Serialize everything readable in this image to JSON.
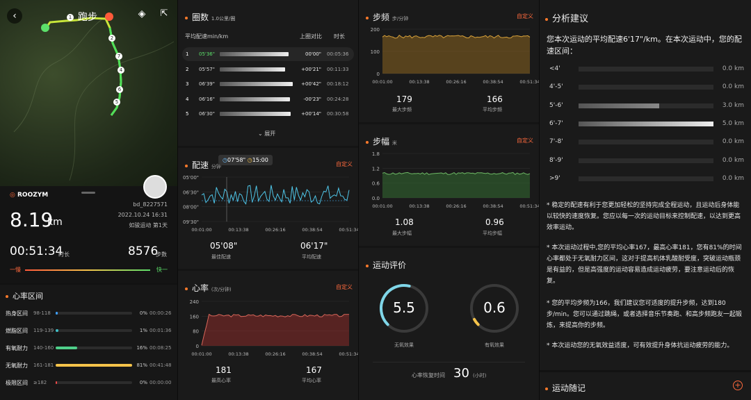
{
  "map": {
    "title": "跑步",
    "km_markers": [
      "1",
      "2",
      "3",
      "4",
      "5",
      "6",
      "7"
    ]
  },
  "summary": {
    "brand": "ROOZYM",
    "user": "bd_8227571",
    "datetime": "2022.10.24 16:31",
    "subtitle": "如骏运动 第1天",
    "distance_value": "8.19",
    "distance_unit": "km",
    "duration_value": "00:51:34",
    "duration_label": "时长",
    "steps_value": "8576",
    "steps_label": "步数",
    "slow_label": "一慢",
    "fast_label": "快一"
  },
  "hr_zone": {
    "title": "心率区间",
    "rows": [
      {
        "name": "热身区间",
        "range": "98-118",
        "pct": "0%",
        "time": "00:00:26",
        "fill": 0.03,
        "color": "#3ea0ff"
      },
      {
        "name": "燃脂区间",
        "range": "119-139",
        "pct": "1%",
        "time": "00:01:36",
        "fill": 0.04,
        "color": "#3fc0c8"
      },
      {
        "name": "有氧耐力",
        "range": "140-160",
        "pct": "16%",
        "time": "00:08:25",
        "fill": 0.28,
        "color": "#4fd08a"
      },
      {
        "name": "无氧耐力",
        "range": "161-181",
        "pct": "81%",
        "time": "00:41:48",
        "fill": 1.0,
        "color": "#f5c34a"
      },
      {
        "name": "极限区间",
        "range": "≥182",
        "pct": "0%",
        "time": "00:00:00",
        "fill": 0.02,
        "color": "#f04848"
      }
    ]
  },
  "laps": {
    "title": "圈数",
    "unit": "1.0公里/圈",
    "col_pace": "平均配速min/km",
    "col_compare": "上圈对比",
    "col_time": "时长",
    "expand": "展开",
    "rows": [
      {
        "n": "1",
        "pace": "05'36\"",
        "cmp": "00'00\"",
        "time": "00:05:36",
        "fill": 0.9,
        "hl": true
      },
      {
        "n": "2",
        "pace": "05'57\"",
        "cmp": "+00'21\"",
        "time": "00:11:33",
        "fill": 0.85,
        "hl": false
      },
      {
        "n": "3",
        "pace": "06'39\"",
        "cmp": "+00'42\"",
        "time": "00:18:12",
        "fill": 0.95,
        "hl": false
      },
      {
        "n": "4",
        "pace": "06'16\"",
        "cmp": "-00'23\"",
        "time": "00:24:28",
        "fill": 0.92,
        "hl": false
      },
      {
        "n": "5",
        "pace": "06'30\"",
        "cmp": "+00'14\"",
        "time": "00:30:58",
        "fill": 0.93,
        "hl": false
      }
    ]
  },
  "pace": {
    "title": "配速",
    "unit": "分钟",
    "custom": "自定义",
    "tooltip_pace": "07'58\"",
    "tooltip_time": "15:00",
    "y_labels": [
      "05'00\"",
      "06'30\"",
      "08'00\"",
      "09'30\""
    ],
    "x_labels": [
      "00:01:00",
      "00:13:38",
      "00:26:16",
      "00:38:54",
      "00:51:34"
    ],
    "best_value": "05'08\"",
    "best_label": "最佳配速",
    "avg_value": "06'17\"",
    "avg_label": "平均配速"
  },
  "heart": {
    "title": "心率",
    "unit": "(次/分钟)",
    "custom": "自定义",
    "y_labels": [
      "240",
      "160",
      "80",
      "0"
    ],
    "x_labels": [
      "00:01:00",
      "00:13:38",
      "00:26:16",
      "00:38:54",
      "00:51:34"
    ],
    "max_value": "181",
    "max_label": "最高心率",
    "avg_value": "167",
    "avg_label": "平均心率"
  },
  "cadence": {
    "title": "步频",
    "unit": "步/分钟",
    "custom": "自定义",
    "y_labels": [
      "200",
      "100",
      "0"
    ],
    "x_labels": [
      "00:01:00",
      "00:13:38",
      "00:26:16",
      "00:38:54",
      "00:51:34"
    ],
    "max_value": "179",
    "max_label": "最大步频",
    "avg_value": "166",
    "avg_label": "平均步频"
  },
  "stride": {
    "title": "步幅",
    "unit": "米",
    "custom": "自定义",
    "y_labels": [
      "1.8",
      "1.2",
      "0.6",
      "0.0"
    ],
    "x_labels": [
      "00:01:00",
      "00:13:38",
      "00:26:16",
      "00:38:54",
      "00:51:34"
    ],
    "max_value": "1.08",
    "max_label": "最大步幅",
    "avg_value": "0.96",
    "avg_label": "平均步幅"
  },
  "eval": {
    "title": "运动评价",
    "anaerobic_value": "5.5",
    "anaerobic_label": "无氧效果",
    "aerobic_value": "0.6",
    "aerobic_label": "有氧效果",
    "anaerobic_level": 0.55,
    "aerobic_level": 0.06,
    "recovery_label": "心率恢复时间",
    "recovery_value": "30",
    "recovery_unit": "(小时)"
  },
  "advice": {
    "title": "分析建议",
    "intro": "您本次运动的平均配速6'17\"/km。在本次运动中，您的配速区间：",
    "rows": [
      {
        "label": "<4'",
        "value": "0.0 km",
        "fill": 0
      },
      {
        "label": "4'-5'",
        "value": "0.0 km",
        "fill": 0
      },
      {
        "label": "5'-6'",
        "value": "3.0 km",
        "fill": 0.6
      },
      {
        "label": "6'-7'",
        "value": "5.0 km",
        "fill": 1.0
      },
      {
        "label": "7'-8'",
        "value": "0.0 km",
        "fill": 0
      },
      {
        "label": "8'-9'",
        "value": "0.0 km",
        "fill": 0
      },
      {
        "label": ">9'",
        "value": "0.0 km",
        "fill": 0
      }
    ],
    "p1": "* 稳定的配速有利于您更加轻松的坚持完成全程运动，且运动后身体能以较快的速度恢复。您应以每一次的运动目标来控制配速，以达到更高效率运动。",
    "p2": "* 本次运动过程中,您的平均心率167，最高心率181，您有81%的时间心率都处于无氧耐力区间，这对于提高机体乳酸耐受度，突破运动瓶颈是有益的，但是高强度的运动容易造成运动疲劳，要注意运动后的恢复。",
    "p3": "* 您的平均步频为166，我们建议您可适度的提升步频，达到180步/min。您可以通过跳绳，或者选择音乐节奏跑、和高步频跑友一起锻炼，来提高你的步频。",
    "p4": "* 本次运动您的无氧效益适度，可有效提升身体抗运动疲劳的能力。",
    "notes_title": "运动随记"
  },
  "colors": {
    "accent": "#ff6a3d",
    "green": "#5ce06a"
  }
}
